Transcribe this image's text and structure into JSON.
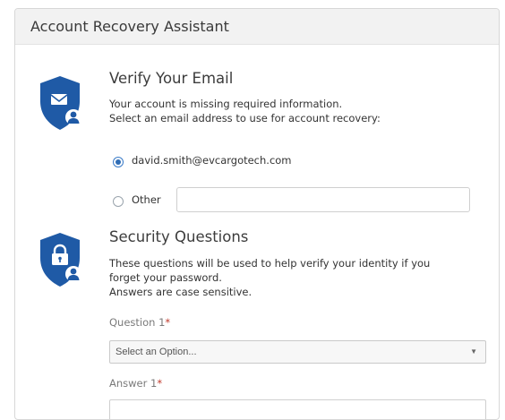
{
  "header": {
    "title": "Account Recovery Assistant"
  },
  "email_section": {
    "title": "Verify Your Email",
    "description_lines": [
      "Your account is missing required information.",
      "Select an email address to use for account recovery:"
    ],
    "options": [
      {
        "label": "david.smith@evcargotech.com",
        "selected": true
      },
      {
        "label": "Other",
        "selected": false
      }
    ],
    "other_value": ""
  },
  "security_section": {
    "title": "Security Questions",
    "description_lines": [
      "These questions will be used to help verify your identity if you",
      "forget your password.",
      "Answers are case sensitive."
    ],
    "question1_label": "Question 1",
    "question1_placeholder": "Select an Option...",
    "answer1_label": "Answer 1",
    "required_mark": "*"
  },
  "icons": {
    "email_shield": "shield-envelope-user-icon",
    "security_shield": "shield-lock-user-icon",
    "dropdown_arrow": "caret-down-icon"
  },
  "colors": {
    "shield_blue": "#1f5aa6",
    "required_red": "#c0392b",
    "radio_selected": "#2f6db5"
  }
}
